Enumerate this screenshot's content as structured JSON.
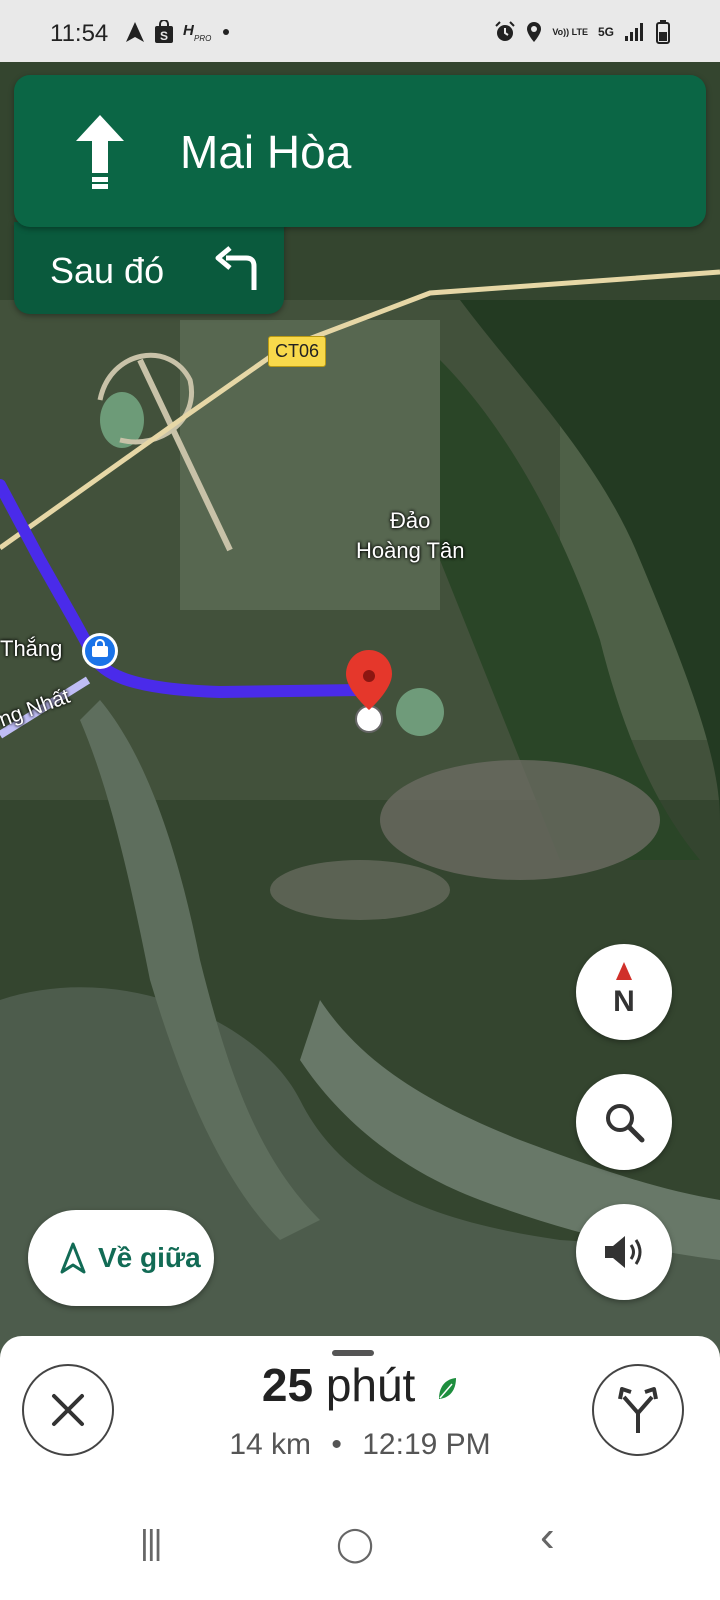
{
  "status_bar": {
    "time": "11:54",
    "left_icons": [
      "navigation-arrow-icon",
      "shopping-bag-icon",
      "app-icon",
      "dot-icon"
    ],
    "volte_label": "Vo)) LTE",
    "network_label": "5G",
    "right_icons": [
      "alarm-icon",
      "location-icon",
      "signal-icon",
      "battery-icon"
    ]
  },
  "navigation": {
    "street": "Mai Hòa",
    "then_label": "Sau đó",
    "maneuver_icon": "straight-arrow-icon",
    "then_icon": "turn-left-icon",
    "colors": {
      "banner": "#0b6645",
      "then_banner": "#0a5a3d"
    }
  },
  "map": {
    "road_shield": "CT06",
    "labels": {
      "island": "Đảo\nHoàng Tân",
      "left_place": "Thắng",
      "left_road": "ng Nhất"
    },
    "route_color": "#4a2bea",
    "destination_pin_color": "#e5372b"
  },
  "controls": {
    "compass_label": "N",
    "recenter_label": "Về giữa"
  },
  "bottom_sheet": {
    "duration_number": "25",
    "duration_unit": "phút",
    "distance": "14 km",
    "separator": "•",
    "arrival_time": "12:19 PM",
    "eco_icon": "leaf-icon"
  },
  "system_nav": {
    "recents": "|||",
    "home": "◯",
    "back": "‹"
  }
}
